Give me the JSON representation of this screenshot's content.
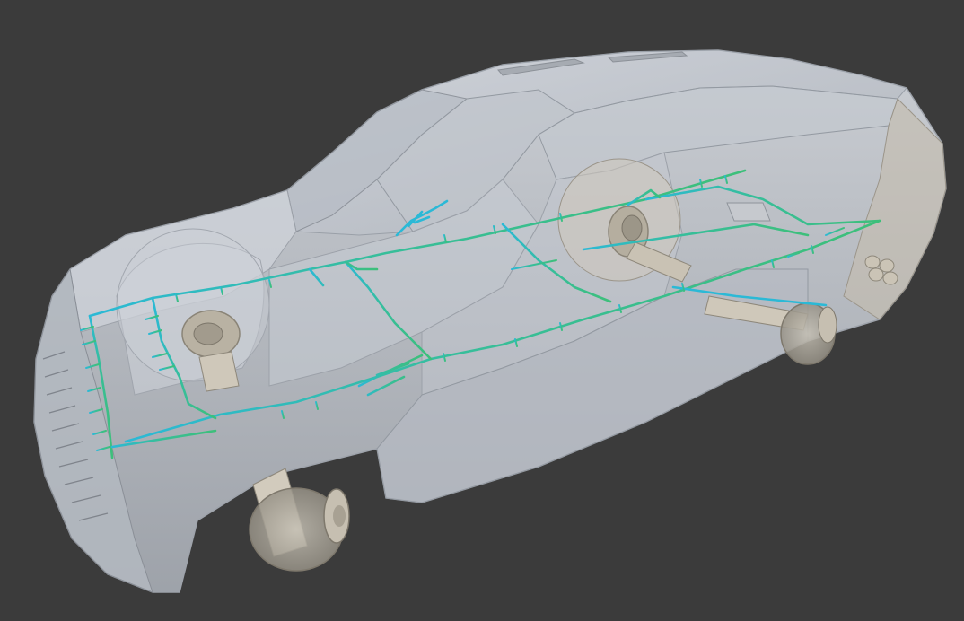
{
  "viewport": {
    "background": "#3b3b3b"
  },
  "model": {
    "subject": "suv-vehicle-xray",
    "body_color": "#c9ced6",
    "body_shadow_color": "#8f949c",
    "chassis_color": "#b8a98f",
    "render_style": "semi-transparent"
  },
  "wiring": {
    "color_start": "#2bb9d6",
    "color_end": "#3dbf7a"
  }
}
